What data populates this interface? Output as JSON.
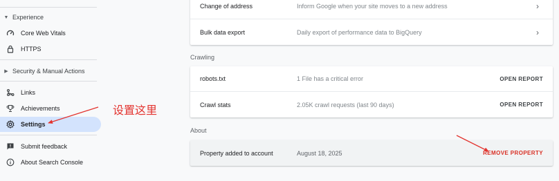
{
  "sidebar": {
    "experience_section": "Experience",
    "items_experience": [
      {
        "label": "Core Web Vitals",
        "icon": "speedometer-icon"
      },
      {
        "label": "HTTPS",
        "icon": "lock-icon"
      }
    ],
    "security_section": "Security & Manual Actions",
    "items_other": [
      {
        "label": "Links",
        "icon": "links-icon"
      },
      {
        "label": "Achievements",
        "icon": "trophy-icon"
      },
      {
        "label": "Settings",
        "icon": "gear-icon"
      }
    ],
    "items_footer": [
      {
        "label": "Submit feedback",
        "icon": "feedback-icon"
      },
      {
        "label": "About Search Console",
        "icon": "info-icon"
      }
    ]
  },
  "annotation": {
    "text": "设置这里",
    "color": "#e3342f"
  },
  "main": {
    "top_card": [
      {
        "name": "Change of address",
        "description": "Inform Google when your site moves to a new address"
      },
      {
        "name": "Bulk data export",
        "description": "Daily export of performance data to BigQuery"
      }
    ],
    "crawling_label": "Crawling",
    "crawling_card": [
      {
        "name": "robots.txt",
        "description": "1 File has a critical error",
        "action": "OPEN REPORT"
      },
      {
        "name": "Crawl stats",
        "description": "2.05K crawl requests (last 90 days)",
        "action": "OPEN REPORT"
      }
    ],
    "about_label": "About",
    "about_card": {
      "name": "Property added to account",
      "date": "August 18, 2025",
      "action": "REMOVE PROPERTY"
    }
  },
  "colors": {
    "accent_active": "#d3e3fd",
    "danger": "#d93025"
  }
}
